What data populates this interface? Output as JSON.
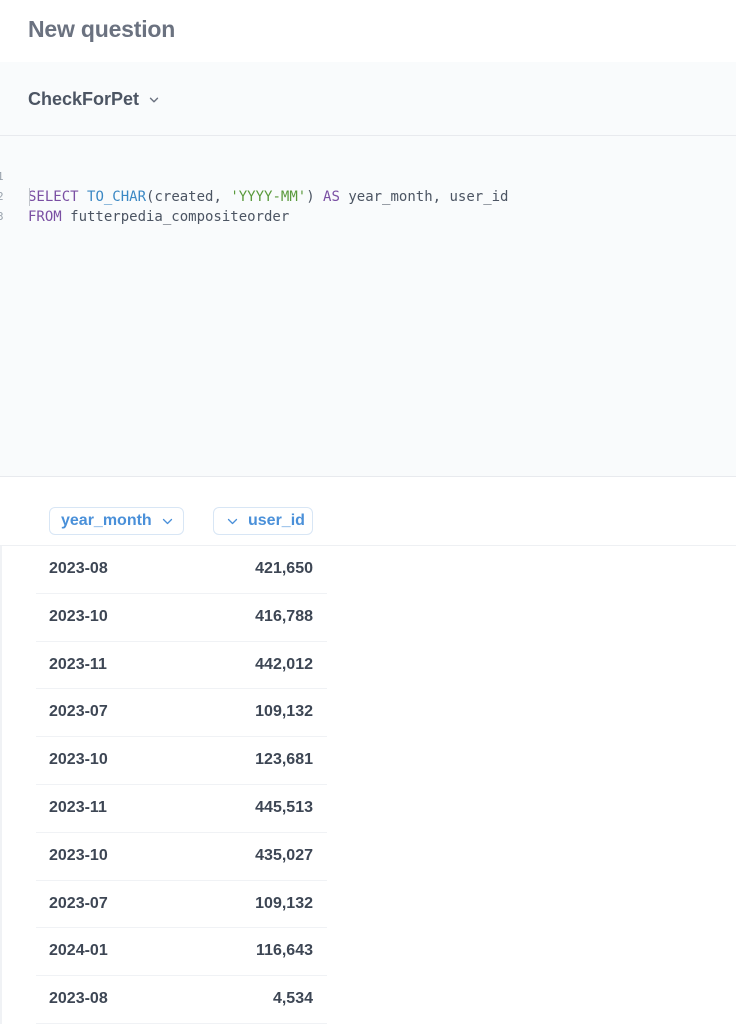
{
  "header": {
    "title": "New question"
  },
  "database": {
    "name": "CheckForPet",
    "icon": "chevron-down-icon"
  },
  "editor": {
    "lines": [
      {
        "number": "1",
        "tokens": [
          {
            "text": "SELECT",
            "kind": "kw"
          },
          {
            "text": " ",
            "kind": "plain"
          },
          {
            "text": "TO_CHAR",
            "kind": "fn"
          },
          {
            "text": "(created, ",
            "kind": "plain"
          },
          {
            "text": "'YYYY-MM'",
            "kind": "str"
          },
          {
            "text": ") ",
            "kind": "plain"
          },
          {
            "text": "AS",
            "kind": "kw"
          },
          {
            "text": " year_month, user_id",
            "kind": "plain"
          }
        ]
      },
      {
        "number": "2",
        "tokens": [
          {
            "text": "FROM",
            "kind": "kw"
          },
          {
            "text": " futterpedia_compositeorder",
            "kind": "plain"
          }
        ]
      },
      {
        "number": "3",
        "tokens": []
      }
    ],
    "colors": {
      "keyword": "#7a4fa3",
      "function": "#3b88c4",
      "string": "#5a9a3c",
      "plain": "#4c5563"
    }
  },
  "results": {
    "columns": [
      {
        "label": "year_month",
        "icon": "chevron-down-icon"
      },
      {
        "label": "user_id",
        "icon": "chevron-down-icon"
      }
    ],
    "rows": [
      {
        "year_month": "2023-08",
        "user_id": "421,650"
      },
      {
        "year_month": "2023-10",
        "user_id": "416,788"
      },
      {
        "year_month": "2023-11",
        "user_id": "442,012"
      },
      {
        "year_month": "2023-07",
        "user_id": "109,132"
      },
      {
        "year_month": "2023-10",
        "user_id": "123,681"
      },
      {
        "year_month": "2023-11",
        "user_id": "445,513"
      },
      {
        "year_month": "2023-10",
        "user_id": "435,027"
      },
      {
        "year_month": "2023-07",
        "user_id": "109,132"
      },
      {
        "year_month": "2024-01",
        "user_id": "116,643"
      },
      {
        "year_month": "2023-08",
        "user_id": "4,534"
      }
    ],
    "accent_color": "#4a90d9"
  }
}
